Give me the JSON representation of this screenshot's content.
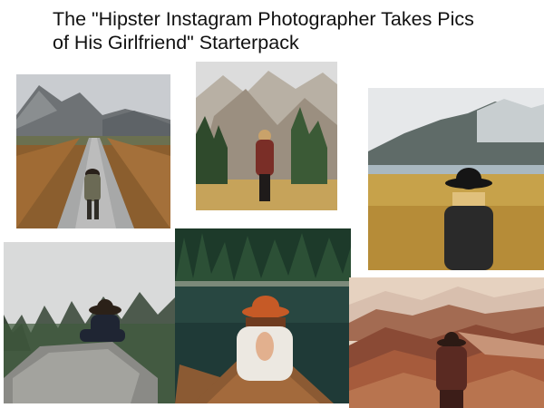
{
  "meme": {
    "title_line1": "The \"Hipster Instagram Photographer Takes Pics",
    "title_line2": "of His Girlfriend\" Starterpack"
  },
  "photos": [
    {
      "scene": "woman-in-hat-on-country-road-mountains"
    },
    {
      "scene": "woman-in-hat-forest-mountain-valley"
    },
    {
      "scene": "woman-in-black-hat-golden-field-lake"
    },
    {
      "scene": "woman-on-rock-foggy-forest"
    },
    {
      "scene": "woman-in-orange-hat-canoe-on-lake"
    },
    {
      "scene": "woman-in-hat-painted-hills"
    }
  ]
}
